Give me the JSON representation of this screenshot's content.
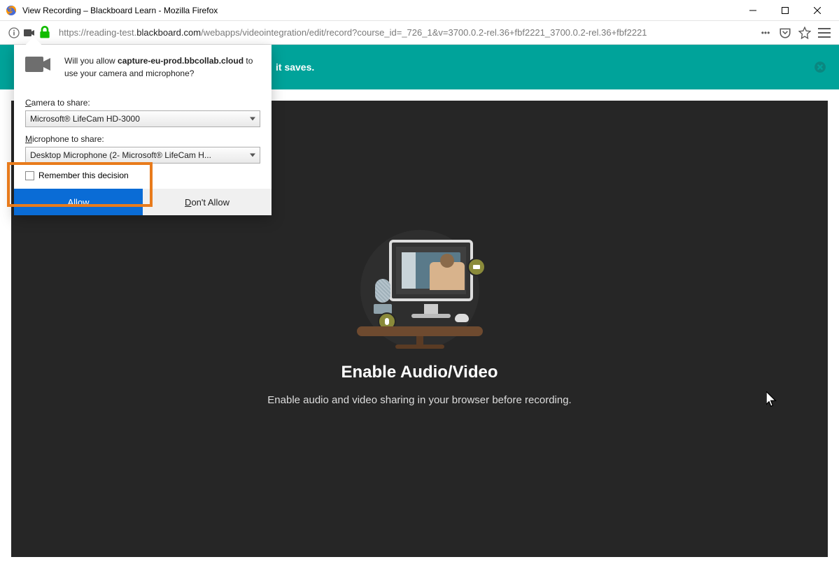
{
  "window": {
    "title": "View Recording – Blackboard Learn - Mozilla Firefox"
  },
  "address": {
    "url_prefix": "https://reading-test.",
    "url_host": "blackboard.com",
    "url_rest": "/webapps/videointegration/edit/record?course_id=_726_1&v=3700.0.2-rel.36+fbf2221_3700.0.2-rel.36+fbf2221"
  },
  "notice": {
    "visible_fragment": "it saves."
  },
  "permission": {
    "line_a": "Will you allow ",
    "domain": "capture-eu-prod.bbcollab.cloud",
    "line_b": " to use your camera and microphone?",
    "camera_label": "Camera to share:",
    "camera_value": "Microsoft® LifeCam HD-3000",
    "mic_label": "Microphone to share:",
    "mic_value": "Desktop Microphone (2- Microsoft® LifeCam H...",
    "remember": "Remember this decision",
    "allow": "Allow",
    "deny": "Don't Allow"
  },
  "content": {
    "heading": "Enable Audio/Video",
    "subtext": "Enable audio and video sharing in your browser before recording."
  }
}
